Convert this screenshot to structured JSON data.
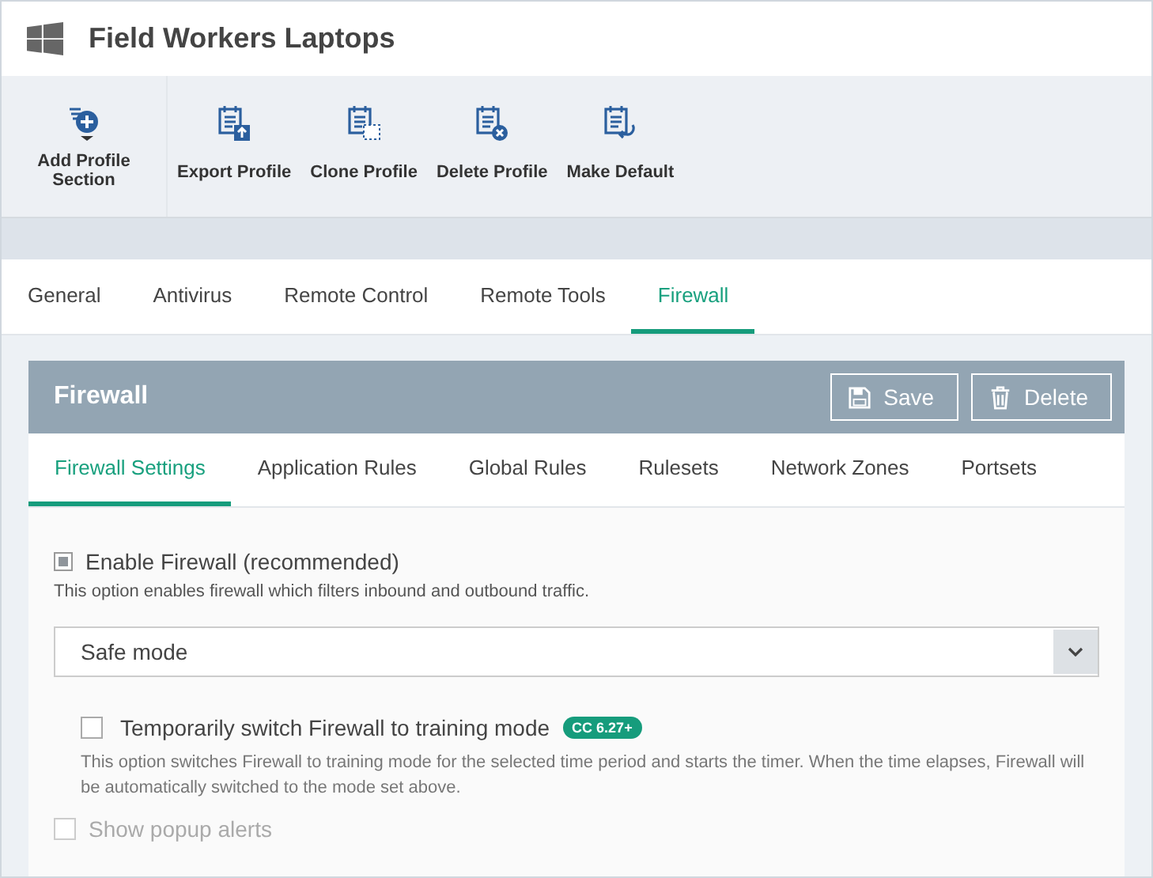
{
  "window": {
    "title": "Field Workers Laptops"
  },
  "toolbar": [
    {
      "label": "Add Profile Section",
      "kind": "add"
    },
    {
      "label": "Export Profile",
      "kind": "export"
    },
    {
      "label": "Clone Profile",
      "kind": "clone"
    },
    {
      "label": "Delete Profile",
      "kind": "delete"
    },
    {
      "label": "Make Default",
      "kind": "default"
    }
  ],
  "tabs": [
    {
      "label": "General",
      "selected": false
    },
    {
      "label": "Antivirus",
      "selected": false
    },
    {
      "label": "Remote Control",
      "selected": false
    },
    {
      "label": "Remote Tools",
      "selected": false
    },
    {
      "label": "Firewall",
      "selected": true
    }
  ],
  "panel": {
    "title": "Firewall",
    "buttons": [
      {
        "label": "Save",
        "kind": "save"
      },
      {
        "label": "Delete",
        "kind": "delete"
      }
    ],
    "subtabs": [
      {
        "label": "Firewall Settings",
        "selected": true
      },
      {
        "label": "Application Rules",
        "selected": false
      },
      {
        "label": "Global Rules",
        "selected": false
      },
      {
        "label": "Rulesets",
        "selected": false
      },
      {
        "label": "Network Zones",
        "selected": false
      },
      {
        "label": "Portsets",
        "selected": false
      }
    ],
    "enable_firewall": {
      "label": "Enable Firewall (recommended)",
      "checked": true,
      "description": "This option enables firewall which filters inbound and outbound traffic."
    },
    "mode_select": {
      "value": "Safe mode"
    },
    "training_mode": {
      "label": "Temporarily switch Firewall to training mode",
      "checked": false,
      "badge": "CC 6.27+",
      "description": "This option switches Firewall to training mode for the selected time period and starts the timer. When the time elapses, Firewall will be automatically switched to the mode set above."
    },
    "popup_alerts": {
      "label": "Show popup alerts",
      "checked": false,
      "disabled": true
    }
  }
}
